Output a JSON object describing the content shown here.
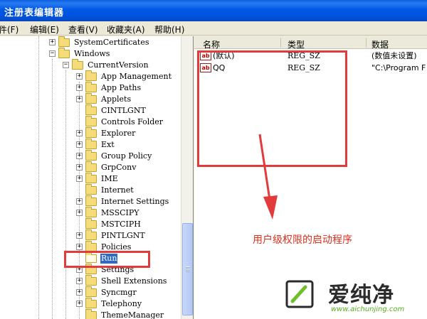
{
  "window": {
    "title": "注册表编辑器"
  },
  "menu": {
    "items": [
      {
        "label": "件(F)"
      },
      {
        "label": "编辑(E)"
      },
      {
        "label": "查看(V)"
      },
      {
        "label": "收藏夹(A)"
      },
      {
        "label": "帮助(H)"
      }
    ]
  },
  "tree": {
    "nodes": [
      {
        "label": "SystemCertificates",
        "expander": "+"
      },
      {
        "label": "Windows",
        "expander": "−"
      },
      {
        "label": "CurrentVersion",
        "expander": "−"
      },
      {
        "label": "App Management",
        "expander": "+"
      },
      {
        "label": "App Paths",
        "expander": "+"
      },
      {
        "label": "Applets",
        "expander": "+"
      },
      {
        "label": "CINTLGNT",
        "expander": ""
      },
      {
        "label": "Controls Folder",
        "expander": ""
      },
      {
        "label": "Explorer",
        "expander": "+"
      },
      {
        "label": "Ext",
        "expander": "+"
      },
      {
        "label": "Group Policy",
        "expander": "+"
      },
      {
        "label": "GrpConv",
        "expander": "+"
      },
      {
        "label": "IME",
        "expander": "+"
      },
      {
        "label": "Internet",
        "expander": ""
      },
      {
        "label": "Internet Settings",
        "expander": "+"
      },
      {
        "label": "MSSCIPY",
        "expander": "+"
      },
      {
        "label": "MSTCIPH",
        "expander": ""
      },
      {
        "label": "PINTLGNT",
        "expander": "+"
      },
      {
        "label": "Policies",
        "expander": "+"
      },
      {
        "label": "Run",
        "expander": "",
        "selected": true
      },
      {
        "label": "Settings",
        "expander": "+"
      },
      {
        "label": "Shell Extensions",
        "expander": "+"
      },
      {
        "label": "Syncmgr",
        "expander": "+"
      },
      {
        "label": "Telephony",
        "expander": "+"
      },
      {
        "label": "ThemeManager",
        "expander": ""
      }
    ]
  },
  "values_pane": {
    "columns": {
      "name": "名称",
      "type": "类型",
      "data": "数据"
    },
    "rows": [
      {
        "icon": "string-value-icon",
        "icon_text": "ab",
        "name": "(默认)",
        "type": "REG_SZ",
        "data": "(数值未设置)"
      },
      {
        "icon": "string-value-icon",
        "icon_text": "ab",
        "name": "QQ",
        "type": "REG_SZ",
        "data": "\"C:\\Program F"
      }
    ]
  },
  "annotation": {
    "text": "用户级权限的启动程序",
    "color": "#e0301e"
  },
  "watermark": {
    "name": "爱纯净",
    "url": "www.aichunjing.com"
  },
  "colors": {
    "title_bar": "#0058e6",
    "selection": "#316ac5",
    "highlight_box": "#e33b3b",
    "folder": "#f5dc7a"
  }
}
